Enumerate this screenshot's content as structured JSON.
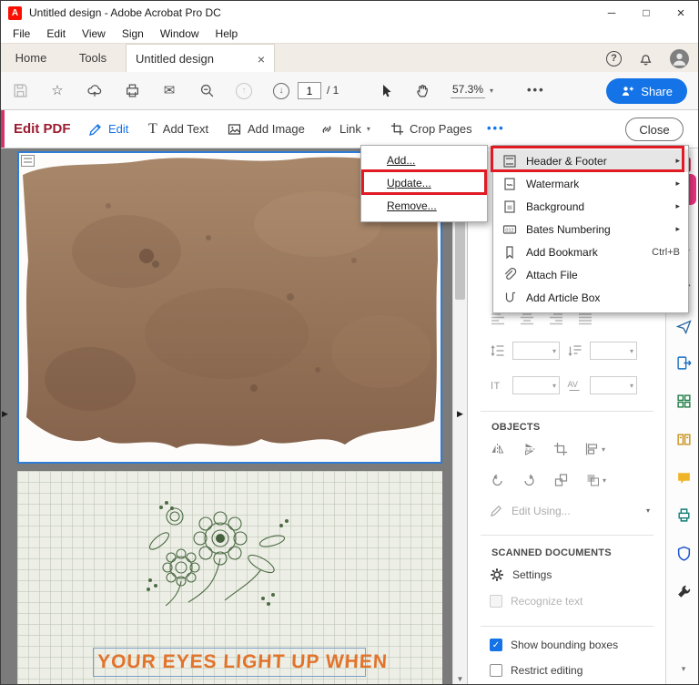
{
  "window": {
    "title": "Untitled design - Adobe Acrobat Pro DC",
    "app_initial": "A",
    "controls": {
      "minimize": "─",
      "maximize": "□",
      "close": "×"
    }
  },
  "menubar": [
    "File",
    "Edit",
    "View",
    "Sign",
    "Window",
    "Help"
  ],
  "tabbar": {
    "home": "Home",
    "tools": "Tools",
    "doc_tab": "Untitled design",
    "help": "?"
  },
  "toolbar": {
    "page": "1",
    "page_total": "/ 1",
    "zoom": "57.3%",
    "more": "•••",
    "share": "Share"
  },
  "editbar": {
    "tool_title": "Edit PDF",
    "edit": "Edit",
    "add_text": "Add Text",
    "add_image": "Add Image",
    "link": "Link",
    "crop": "Crop Pages",
    "more": "•••",
    "close": "Close"
  },
  "context_menu": {
    "items": [
      {
        "label": "Add..."
      },
      {
        "label": "Update...",
        "annotated": true
      },
      {
        "label": "Remove..."
      }
    ]
  },
  "submenu": {
    "items": [
      {
        "label": "Header & Footer",
        "icon": "header-footer",
        "expands": true,
        "selected": true,
        "annotated": true
      },
      {
        "label": "Watermark",
        "icon": "watermark",
        "expands": true
      },
      {
        "label": "Background",
        "icon": "background",
        "expands": true
      },
      {
        "label": "Bates Numbering",
        "icon": "bates-numbering",
        "expands": true
      },
      {
        "label": "Add Bookmark",
        "icon": "bookmark",
        "shortcut": "Ctrl+B"
      },
      {
        "label": "Attach File",
        "icon": "paperclip"
      },
      {
        "label": "Add Article Box",
        "icon": "article-box"
      }
    ]
  },
  "panel": {
    "objects_title": "OBJECTS",
    "edit_using": "Edit Using...",
    "scanned_title": "SCANNED DOCUMENTS",
    "settings": "Settings",
    "recognize_text": "Recognize text",
    "show_bounding_boxes": "Show bounding boxes",
    "restrict_editing": "Restrict editing"
  },
  "document": {
    "page2_caption": "YOUR EYES LIGHT UP WHEN"
  },
  "right_strip": {
    "icons": [
      "create-pdf",
      "edit-pdf",
      "fill-sign",
      "request-signatures",
      "send-file",
      "export-pdf",
      "combine-files",
      "organize-pages",
      "comment",
      "scan-ocr",
      "protect",
      "more-tools"
    ]
  },
  "glyphs": {
    "star": "☆",
    "mail": "✉",
    "up": "↑",
    "down": "↓",
    "caret_down": "▾",
    "arrow_right": "▸",
    "play": "▶",
    "scroll_up": "▲",
    "scroll_down": "▼",
    "check": "✓",
    "t": "T"
  },
  "colors": {
    "accent_blue": "#1473e6",
    "annotation_red": "#e01b24",
    "edit_pdf_red": "#9b1b30",
    "active_tool_pink": "#e9327f",
    "caption_orange": "#e2732a",
    "selection_blue": "#2e7cd6"
  }
}
